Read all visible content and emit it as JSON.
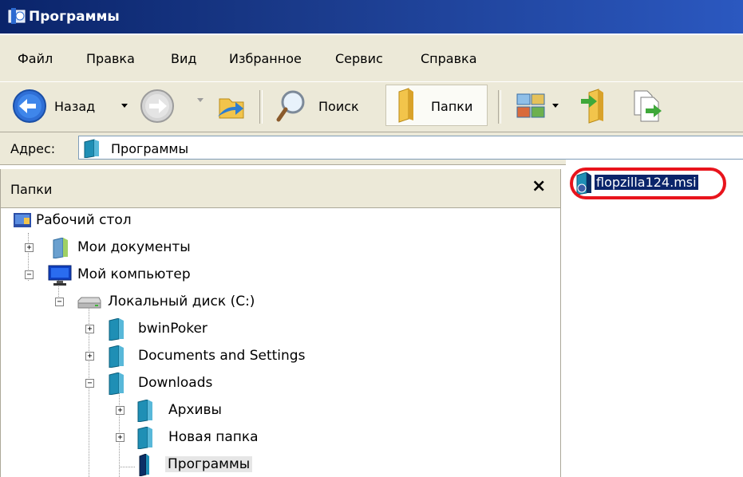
{
  "window": {
    "title": "Программы"
  },
  "menu": [
    "Файл",
    "Правка",
    "Вид",
    "Избранное",
    "Сервис",
    "Справка"
  ],
  "toolbar": {
    "back_label": "Назад",
    "search_label": "Поиск",
    "folders_label": "Папки"
  },
  "address": {
    "label": "Адрес:",
    "value": "Программы"
  },
  "folders_pane": {
    "title": "Папки",
    "close_glyph": "×",
    "tree": {
      "desktop": "Рабочий стол",
      "my_documents": "Мои документы",
      "my_computer": "Мой компьютер",
      "local_disk": "Локальный диск (C:)",
      "bwinpoker": "bwinPoker",
      "documents_settings": "Documents and Settings",
      "downloads": "Downloads",
      "archives": "Архивы",
      "new_folder": "Новая папка",
      "programs": "Программы"
    }
  },
  "files": [
    {
      "name": "flopzilla124.msi",
      "selected": true,
      "highlighted": true
    }
  ],
  "colors": {
    "titlebar": "#0a246a",
    "chrome": "#ece9d8",
    "selection": "#0a246a",
    "highlight_ring": "#e8141c"
  }
}
